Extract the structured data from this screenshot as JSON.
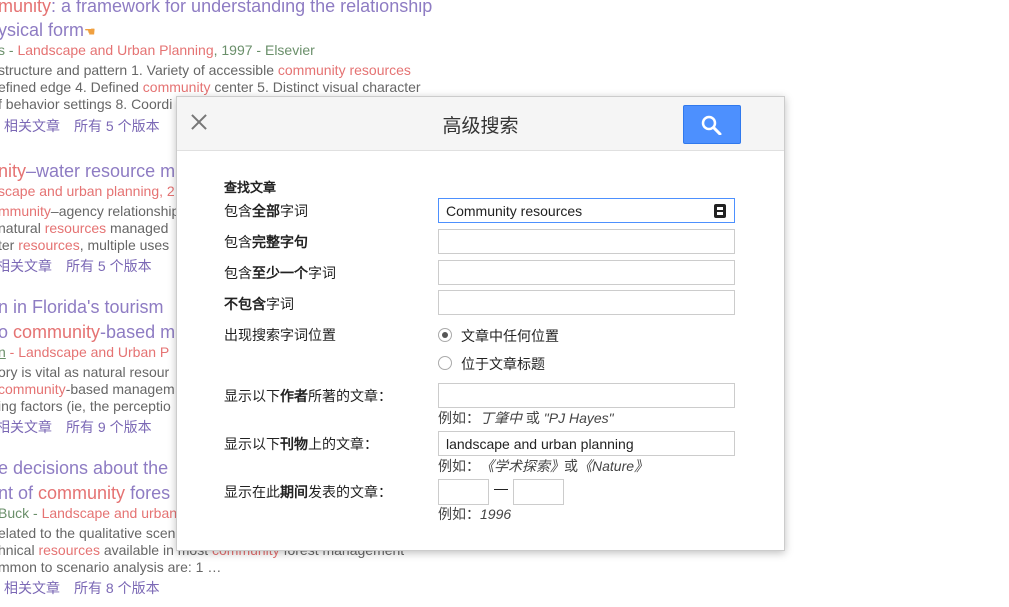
{
  "background": {
    "r1": {
      "title_a": "munity",
      "title_b": ": a framework for understanding the relationship",
      "title2": "ysical form",
      "meta_a": "s - ",
      "meta_b": "Landscape and Urban Planning",
      "meta_c": ", 1997 - ",
      "meta_d": "Elsevier",
      "snip1_a": " structure and pattern 1. Variety of accessible ",
      "snip1_b": "community resources",
      "snip2_a": "efined edge 4. Defined ",
      "snip2_b": "community",
      "snip2_c": " center 5. Distinct visual character",
      "snip3": "f behavior settings 8. Coordi",
      "related": "相关文章",
      "versions": "所有 5 个版本"
    },
    "r2": {
      "title_a": "nity",
      "title_b": "–water resource m",
      "meta": "scape and urban planning, 2",
      "snip1_a": "mmunity",
      "snip1_b": "–agency relationship",
      "snip2_a": " natural ",
      "snip2_b": "resources",
      "snip2_c": " managed",
      "snip3_a": "ter ",
      "snip3_b": "resources",
      "snip3_c": ", multiple uses",
      "related": "相关文章",
      "versions": "所有 5 个版本"
    },
    "r3": {
      "title1": "n in Florida's tourism",
      "title2_a": "o ",
      "title2_b": "community",
      "title2_c": "-based m",
      "meta_a": "n",
      "meta_b": " - Landscape and Urban P",
      "snip1": "ory is vital as natural resour",
      "snip2_a": "community",
      "snip2_b": "-based managem",
      "snip3": "ing factors (ie, the perceptio",
      "related": "相关文章",
      "versions": "所有 9 个版本"
    },
    "r4": {
      "title1": "e decisions about the",
      "title2_a": "nt of ",
      "title2_b": "community",
      "title2_c": " fores",
      "meta_a": "Buck - ",
      "meta_b": "Landscape and urban",
      "snip1": "elated to the qualitative scen",
      "snip2_a": "hnical ",
      "snip2_b": "resources",
      "snip2_c": " available in most ",
      "snip2_d": "community",
      "snip2_e": " forest management",
      "snip3": "mmon to scenario analysis are: 1 …",
      "related": "相关文章",
      "versions": "所有 8 个版本"
    }
  },
  "dialog": {
    "title": "高级搜索",
    "section": "查找文章",
    "all_words": {
      "pre": "包含",
      "bold": "全部",
      "post": "字词",
      "value": "Community resources"
    },
    "exact_phrase": {
      "pre": "包含",
      "bold": "完整字句",
      "post": "",
      "value": ""
    },
    "at_least_one": {
      "pre": "包含",
      "bold": "至少一个",
      "post": "字词",
      "value": ""
    },
    "without": {
      "pre": "",
      "bold": "不包含",
      "post": "字词",
      "value": ""
    },
    "occurrence": {
      "label": "出现搜索字词位置",
      "opt1": "文章中任何位置",
      "opt2": "位于文章标题",
      "selected": "opt1"
    },
    "author": {
      "pre": "显示以下",
      "bold": "作者",
      "post": "所著的文章：",
      "value": "",
      "hint_pre": "例如：",
      "hint_ex1": "丁肇中",
      "hint_or": " 或 ",
      "hint_ex2": "\"PJ Hayes\""
    },
    "publication": {
      "pre": "显示以下",
      "bold": "刊物",
      "post": "上的文章：",
      "value": "landscape and urban planning",
      "hint_pre": "例如：",
      "hint_ex1": "《学术探索》",
      "hint_or": "或",
      "hint_ex2": "《Nature》"
    },
    "date": {
      "pre": "显示在此",
      "bold": "期间",
      "post": "发表的文章：",
      "hint_pre": "例如：",
      "hint_ex": "1996"
    }
  },
  "icons": {
    "close": "close-icon",
    "search": "search-icon",
    "keyboard": "keyboard-icon"
  },
  "colors": {
    "accent": "#4d90fe",
    "title": "#8e7cc3",
    "highlight": "#e57373"
  }
}
